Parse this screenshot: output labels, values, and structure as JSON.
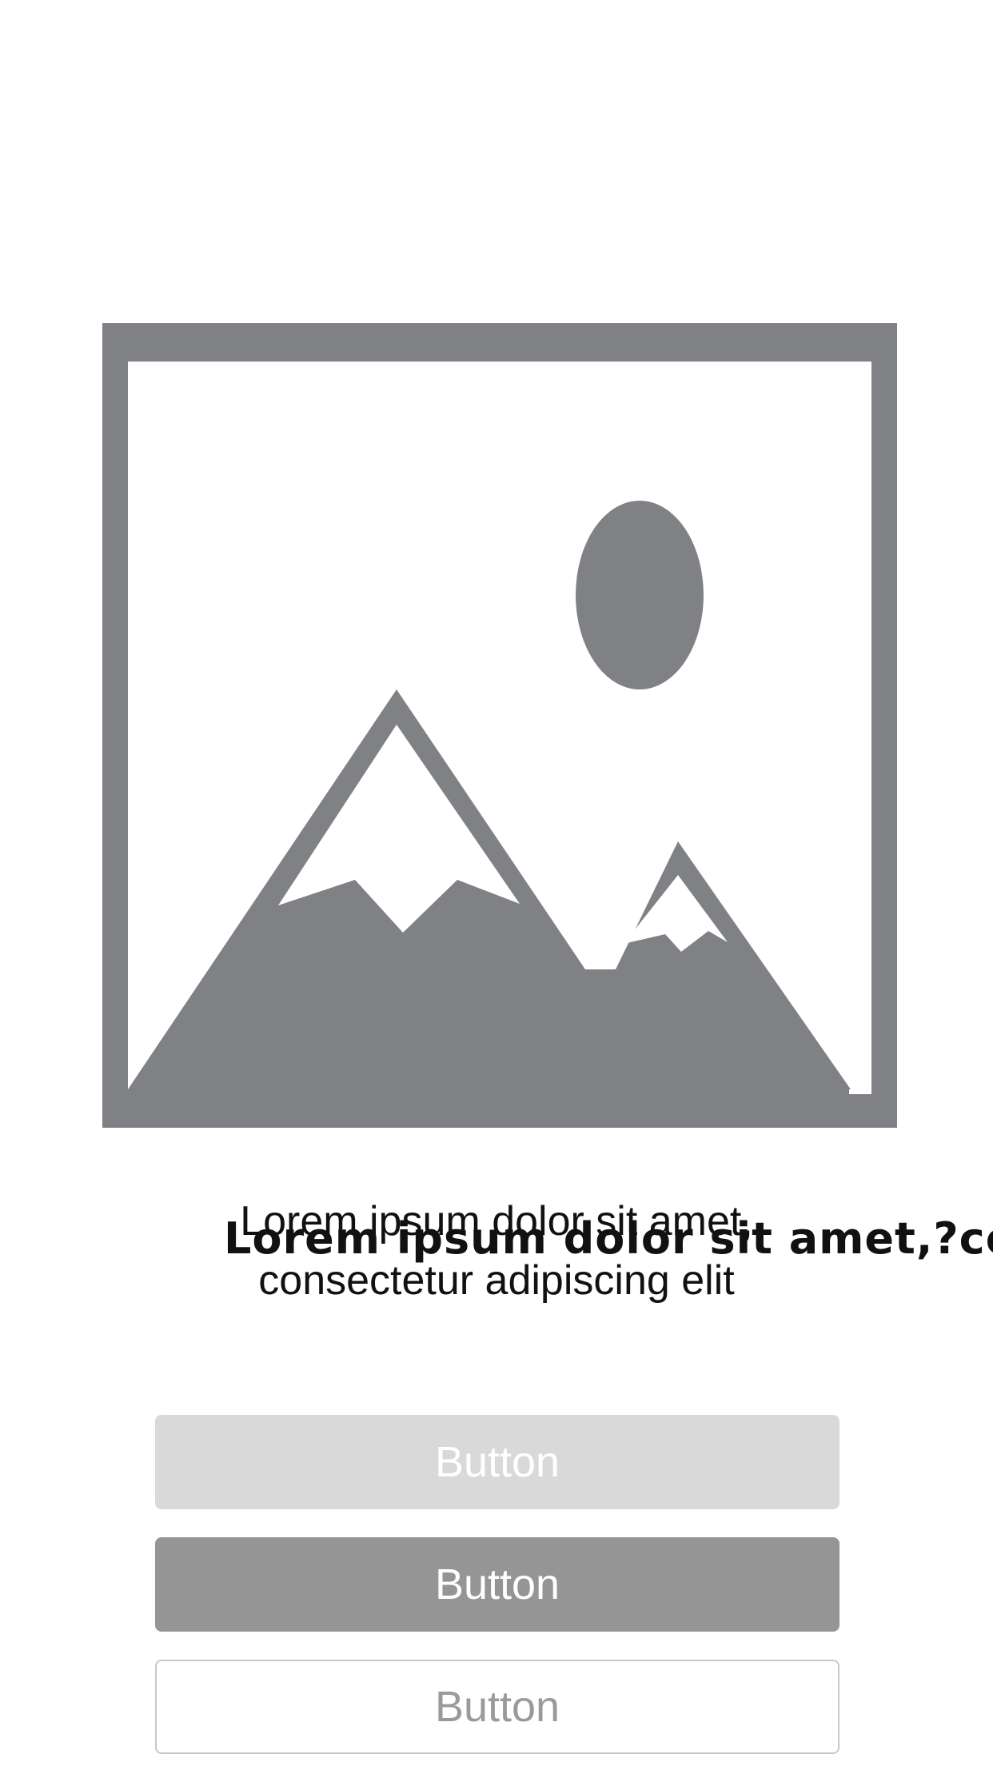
{
  "image": {
    "icon": "image-placeholder-icon",
    "frame_color": "#808184",
    "background_color": "#ffffff"
  },
  "text": {
    "primary": "Lorem ipsum dolor sit amet, consectetur adipiscing elit",
    "overlay": "Lorem ipsum dolor sit amet,?cor"
  },
  "buttons": {
    "disabled_label": "Button",
    "primary_label": "Button",
    "outline_label": "Button"
  },
  "colors": {
    "button_disabled_bg": "#d9d9d9",
    "button_primary_bg": "#959595",
    "button_outline_border": "#c8c8c8",
    "button_outline_text": "#9a9a9a"
  }
}
